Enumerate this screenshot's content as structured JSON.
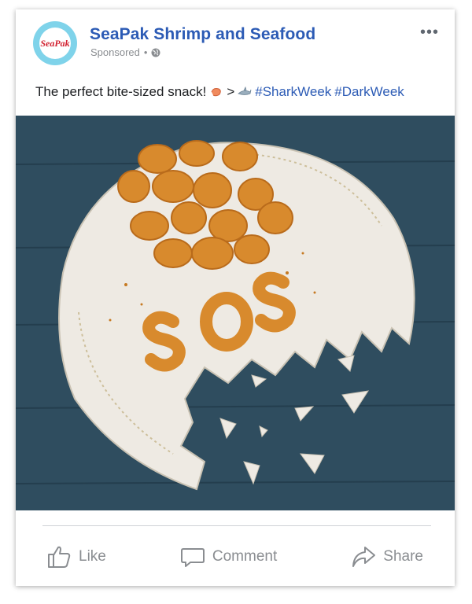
{
  "post": {
    "page_name": "SeaPak Shrimp and Seafood",
    "sponsored_label": "Sponsored",
    "separator": "•",
    "logo_text": "SeaPak",
    "more_icon": "more-dots-icon",
    "caption": {
      "text": "The perfect bite-sized snack!",
      "emoji_shrimp": "shrimp-emoji",
      "gt": ">",
      "emoji_shark": "shark-emoji",
      "hashtag1": "#SharkWeek",
      "hashtag2": "#DarkWeek"
    },
    "image": {
      "description_text": "SOS",
      "subject": "fried popcorn shrimp on broken plate"
    }
  },
  "actions": {
    "like": "Like",
    "comment": "Comment",
    "share": "Share"
  },
  "colors": {
    "link_blue": "#2c5bb5",
    "muted_gray": "#8a8d91",
    "wood_blue": "#2f4d5f"
  }
}
